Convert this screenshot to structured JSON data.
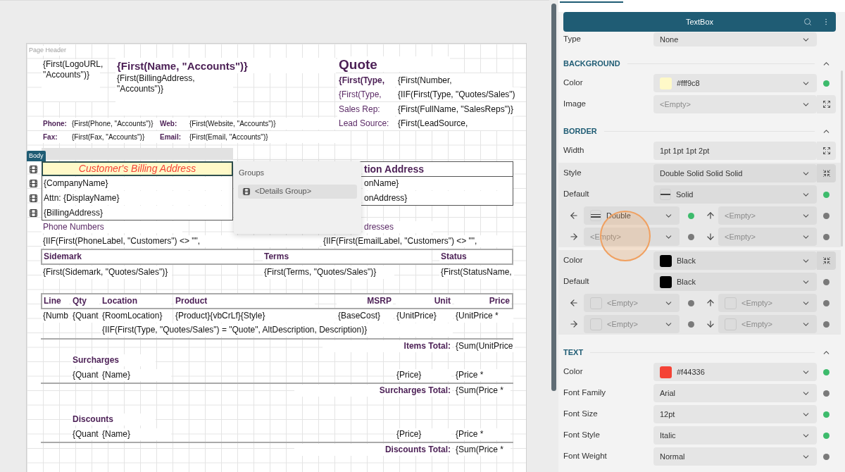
{
  "report": {
    "page_header": {
      "label": "Page Header",
      "items": [
        {
          "kind": "field",
          "text": "{First(LogoURL, \"Accounts\")}",
          "selected": false
        },
        {
          "kind": "title",
          "text": "{First(Name, \"Accounts\")}",
          "selected": false
        },
        {
          "kind": "field",
          "text": "{First(BillingAddress, \"Accounts\")}",
          "selected": false
        },
        {
          "kind": "title_large",
          "text": "Quote",
          "selected": false
        },
        {
          "kind": "label_bold",
          "text": "{First(Type,",
          "selected": false
        },
        {
          "kind": "field",
          "text": "{First(Number,",
          "selected": false
        },
        {
          "kind": "label",
          "text": "{First(Type,",
          "selected": false
        },
        {
          "kind": "field",
          "text": "{IIF(First(Type, \"Quotes/Sales\")",
          "selected": false
        },
        {
          "kind": "label",
          "text": "Sales Rep:",
          "selected": false
        },
        {
          "kind": "field",
          "text": "{First(FullName, \"SalesReps\")}",
          "selected": false
        },
        {
          "kind": "label_small",
          "text": "Phone:",
          "selected": false
        },
        {
          "kind": "field_small",
          "text": "{First(Phone, \"Accounts\")}",
          "selected": false
        },
        {
          "kind": "label_small",
          "text": "Web:",
          "selected": false
        },
        {
          "kind": "field_small",
          "text": "{First(Website, \"Accounts\")}",
          "selected": false
        },
        {
          "kind": "label",
          "text": "Lead Source:",
          "selected": false
        },
        {
          "kind": "field",
          "text": "{First(LeadSource,",
          "selected": false
        },
        {
          "kind": "label_small",
          "text": "Fax:",
          "selected": false
        },
        {
          "kind": "field_small",
          "text": "{First(Fax, \"Accounts\")}",
          "selected": false
        },
        {
          "kind": "label_small",
          "text": "Email:",
          "selected": false
        },
        {
          "kind": "field_small",
          "text": "{First(Email, \"Accounts\")}",
          "selected": false
        }
      ]
    },
    "body": {
      "label": "Body",
      "items": [
        {
          "kind": "heading",
          "text": "Customer's Billing Address",
          "selected": true
        },
        {
          "kind": "field",
          "text": "{CompanyName}",
          "selected": false
        },
        {
          "kind": "field",
          "text": "Attn: {DisplayName}",
          "selected": false
        },
        {
          "kind": "field",
          "text": "{BillingAddress}",
          "selected": false
        },
        {
          "kind": "heading",
          "text": "tion Address",
          "selected": false
        },
        {
          "kind": "field",
          "text": "onName}",
          "selected": false
        },
        {
          "kind": "field",
          "text": "onAddress}",
          "selected": false
        },
        {
          "kind": "label",
          "text": "Phone Numbers",
          "selected": false
        },
        {
          "kind": "label",
          "text": "dresses",
          "selected": false
        },
        {
          "kind": "field",
          "text": "{IIF(First(PhoneLabel, \"Customers\") <> \"\",",
          "selected": false
        },
        {
          "kind": "field",
          "text": "{IIF(First(EmailLabel, \"Customers\") <> \"\",",
          "selected": false
        },
        {
          "kind": "label_bold",
          "text": "Sidemark",
          "selected": false
        },
        {
          "kind": "label_bold",
          "text": "Terms",
          "selected": false
        },
        {
          "kind": "label_bold",
          "text": "Status",
          "selected": false
        },
        {
          "kind": "field",
          "text": "{First(Sidemark, \"Quotes/Sales\")}",
          "selected": false
        },
        {
          "kind": "field",
          "text": "{First(Terms, \"Quotes/Sales\")}",
          "selected": false
        },
        {
          "kind": "field",
          "text": "{First(StatusName,",
          "selected": false
        },
        {
          "kind": "label_bold",
          "text": "Line",
          "selected": false
        },
        {
          "kind": "label_bold",
          "text": "Qty",
          "selected": false
        },
        {
          "kind": "label_bold",
          "text": "Location",
          "selected": false
        },
        {
          "kind": "label_bold",
          "text": "Product",
          "selected": false
        },
        {
          "kind": "label_bold",
          "text": "MSRP",
          "selected": false
        },
        {
          "kind": "label_bold",
          "text": "Unit",
          "selected": false
        },
        {
          "kind": "label_bold",
          "text": "Price",
          "selected": false
        },
        {
          "kind": "field",
          "text": "{Numb",
          "selected": false
        },
        {
          "kind": "field",
          "text": "{Quant",
          "selected": false
        },
        {
          "kind": "field",
          "text": "{RoomLocation}",
          "selected": false
        },
        {
          "kind": "field",
          "text": "{Product}{vbCrLf}{Style}",
          "selected": false
        },
        {
          "kind": "field",
          "text": "{BaseCost}",
          "selected": false
        },
        {
          "kind": "field",
          "text": "{UnitPrice}",
          "selected": false
        },
        {
          "kind": "field",
          "text": "{UnitPrice *",
          "selected": false
        },
        {
          "kind": "field",
          "text": "{IIF(First(Type, \"Quotes/Sales\") = \"Quote\", AltDescription, Description)}",
          "selected": false
        },
        {
          "kind": "label_bold",
          "text": "Items Total:",
          "selected": false
        },
        {
          "kind": "field",
          "text": "{Sum(UnitPrice",
          "selected": false
        },
        {
          "kind": "label_bold",
          "text": "Surcharges",
          "selected": false
        },
        {
          "kind": "field",
          "text": "{Quant",
          "selected": false
        },
        {
          "kind": "field",
          "text": "{Name}",
          "selected": false
        },
        {
          "kind": "field",
          "text": "{Price}",
          "selected": false
        },
        {
          "kind": "field",
          "text": "{Price *",
          "selected": false
        },
        {
          "kind": "label_bold",
          "text": "Surcharges Total:",
          "selected": false
        },
        {
          "kind": "field",
          "text": "{Sum(Price *",
          "selected": false
        },
        {
          "kind": "label_bold",
          "text": "Discounts",
          "selected": false
        },
        {
          "kind": "field",
          "text": "{Quant",
          "selected": false
        },
        {
          "kind": "field",
          "text": "{Name}",
          "selected": false
        },
        {
          "kind": "field",
          "text": "{Price}",
          "selected": false
        },
        {
          "kind": "field",
          "text": "{Price *",
          "selected": false
        },
        {
          "kind": "label_bold",
          "text": "Discounts Total:",
          "selected": false
        },
        {
          "kind": "field",
          "text": "{Sum(Price *",
          "selected": false
        }
      ]
    },
    "groups_popup": {
      "title": "Groups",
      "items": [
        {
          "label": "<Details Group>",
          "selected": true
        }
      ]
    }
  },
  "properties": {
    "title": "TextBox",
    "rows": [
      {
        "kind": "prop",
        "label": "Type",
        "value": "None",
        "dropdown": true
      },
      {
        "kind": "section",
        "title": "BACKGROUND",
        "expanded": true
      },
      {
        "kind": "prop",
        "label": "Color",
        "value": "#fff9c8",
        "color": "#fff9c8",
        "dropdown": true,
        "modified": true
      },
      {
        "kind": "prop",
        "label": "Image",
        "placeholder": "<Empty>",
        "dropdown": true,
        "expand_button": true
      },
      {
        "kind": "section",
        "title": "BORDER",
        "expanded": true
      },
      {
        "kind": "prop",
        "label": "Width",
        "value": "1pt 1pt 1pt 2pt",
        "dropdown": false,
        "expand_button": true
      },
      {
        "kind": "group",
        "label": "Style",
        "value": "Double Solid Solid Solid",
        "dropdown": true,
        "collapse_button": true,
        "rows": [
          {
            "kind": "prop",
            "label": "Default",
            "value": "Solid",
            "single_line": true,
            "dropdown": true,
            "modified": true
          },
          {
            "kind": "sides",
            "cells": [
              {
                "kind": "left",
                "value": "Double",
                "double_line": true,
                "modified": true
              },
              {
                "kind": "up",
                "placeholder": "<Empty>",
                "modified": false
              }
            ]
          },
          {
            "kind": "sides",
            "cells": [
              {
                "kind": "right",
                "placeholder": "<Empty>",
                "modified": false
              },
              {
                "kind": "down",
                "placeholder": "<Empty>",
                "modified": false
              }
            ]
          }
        ]
      },
      {
        "kind": "group",
        "label": "Color",
        "value": "Black",
        "color": "#000000",
        "dropdown": true,
        "collapse_button": true,
        "rows": [
          {
            "kind": "prop",
            "label": "Default",
            "value": "Black",
            "color": "#000000",
            "dropdown": true,
            "modified": false
          },
          {
            "kind": "sides",
            "cells": [
              {
                "kind": "left",
                "placeholder": "<Empty>",
                "empty_swatch": true,
                "modified": false
              },
              {
                "kind": "up",
                "placeholder": "<Empty>",
                "empty_swatch": true,
                "modified": false
              }
            ]
          },
          {
            "kind": "sides",
            "cells": [
              {
                "kind": "right",
                "placeholder": "<Empty>",
                "empty_swatch": true,
                "modified": false
              },
              {
                "kind": "down",
                "placeholder": "<Empty>",
                "empty_swatch": true,
                "modified": false
              }
            ]
          }
        ]
      },
      {
        "kind": "section",
        "title": "TEXT",
        "expanded": true
      },
      {
        "kind": "prop",
        "label": "Color",
        "value": "#f44336",
        "color": "#f44336",
        "dropdown": true,
        "modified": true
      },
      {
        "kind": "prop",
        "label": "Font Family",
        "value": "Arial",
        "dropdown": true,
        "modified": false
      },
      {
        "kind": "prop",
        "label": "Font Size",
        "value": "12pt",
        "dropdown": true,
        "modified": true
      },
      {
        "kind": "prop",
        "label": "Font Style",
        "value": "Italic",
        "dropdown": true,
        "modified": true
      },
      {
        "kind": "prop",
        "label": "Font Weight",
        "value": "Normal",
        "dropdown": true,
        "modified": false
      }
    ]
  }
}
